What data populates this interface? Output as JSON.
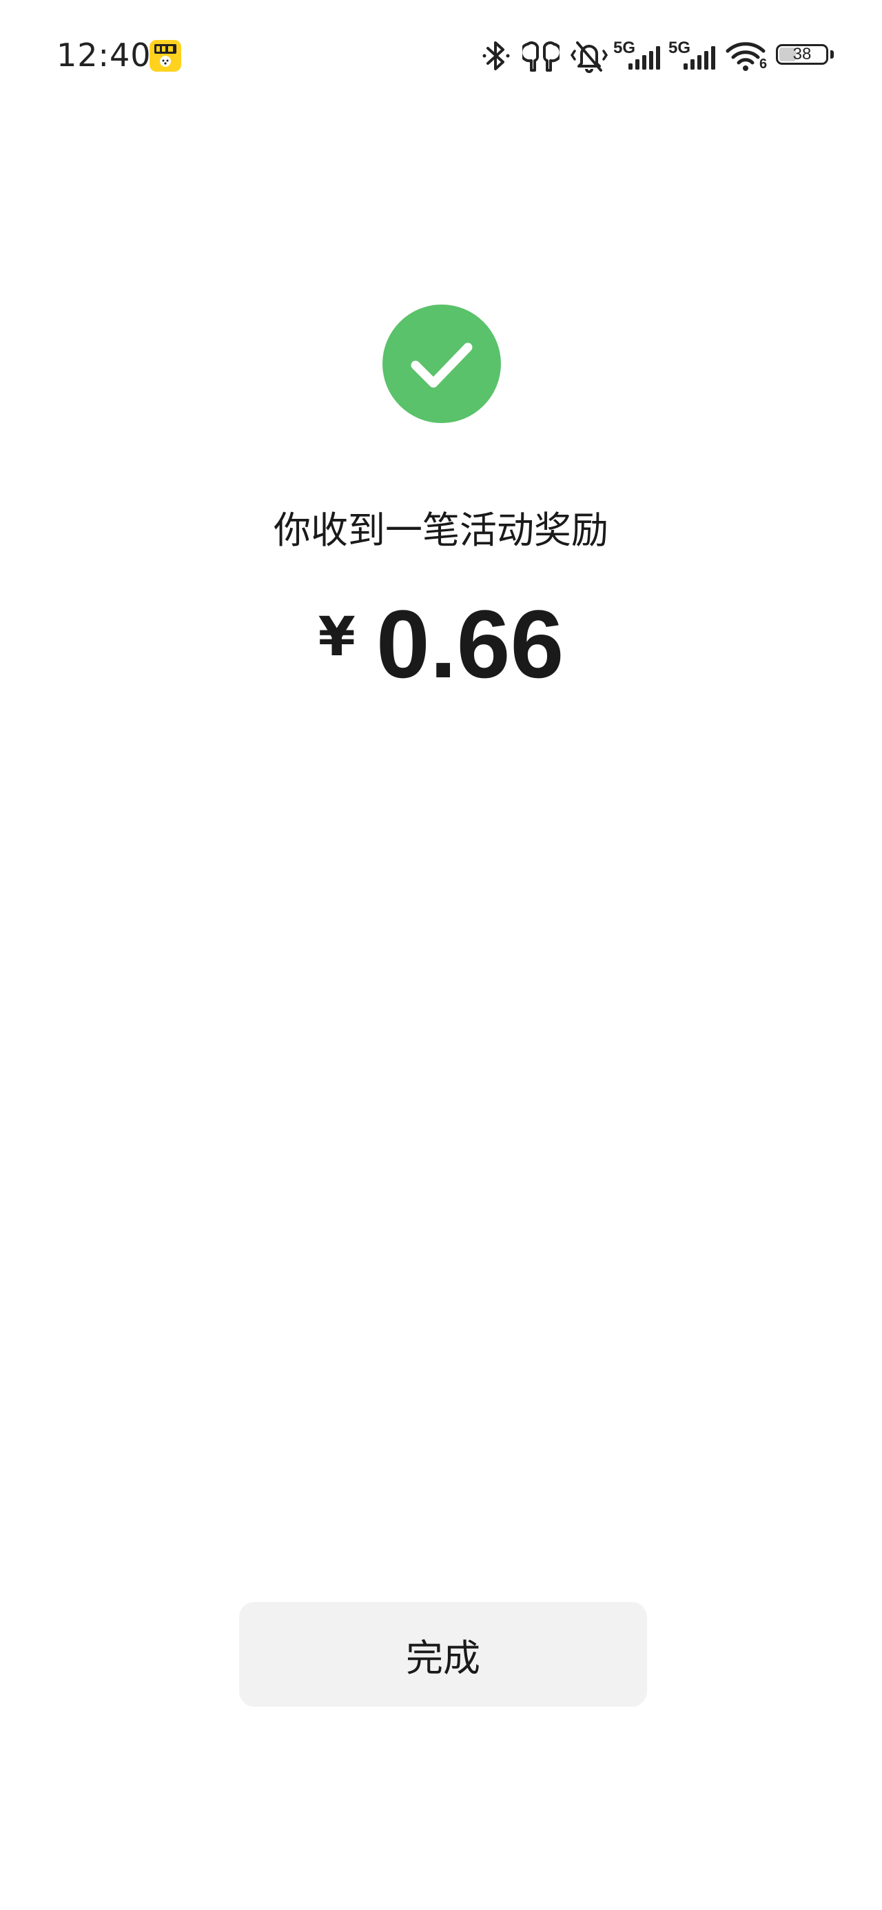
{
  "status_bar": {
    "time": "12:40",
    "battery_level": "38",
    "network_1": "5G",
    "network_2": "5G",
    "wifi_badge": "6",
    "icons": [
      "app-badge-icon",
      "bluetooth-icon",
      "earbuds-icon",
      "vibrate-mute-icon",
      "signal-icon",
      "signal-icon",
      "wifi-icon",
      "battery-icon"
    ]
  },
  "result": {
    "icon": "check-icon",
    "message": "你收到一笔活动奖励",
    "currency_symbol": "¥",
    "amount": "0.66"
  },
  "actions": {
    "done_label": "完成"
  },
  "colors": {
    "success_green": "#5ac26a",
    "button_background": "#f2f2f2",
    "badge_yellow": "#ffd21f",
    "text": "#1a1a1a"
  }
}
